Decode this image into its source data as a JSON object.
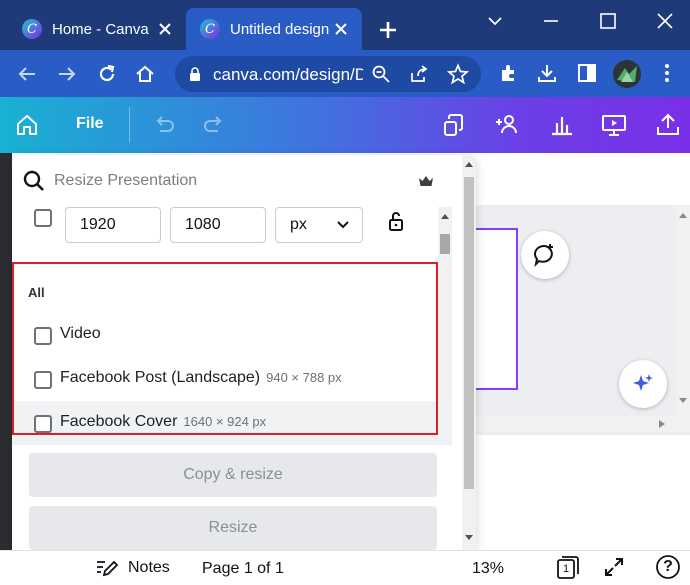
{
  "browser": {
    "tabs": [
      {
        "title": "Home - Canva",
        "active": false
      },
      {
        "title": "Untitled design",
        "active": true
      }
    ],
    "url": "canva.com/design/DAFh...",
    "accent": "#2a5cc6"
  },
  "canva_header": {
    "file_label": "File",
    "gradient_start": "#19b1d2",
    "gradient_end": "#7b2fe8"
  },
  "resize_panel": {
    "search_placeholder": "Resize Presentation",
    "width": "1920",
    "height": "1080",
    "unit": "px",
    "section_label": "All",
    "items": [
      {
        "label": "Video",
        "dimensions": ""
      },
      {
        "label": "Facebook Post (Landscape)",
        "dimensions": "940 × 788 px"
      },
      {
        "label": "Facebook Cover",
        "dimensions": "1640 × 924 px"
      }
    ],
    "copy_resize_label": "Copy & resize",
    "resize_label": "Resize",
    "highlight_color": "#e11d2a"
  },
  "bottom_bar": {
    "notes_label": "Notes",
    "page_info": "Page 1 of 1",
    "zoom": "13%",
    "page_count": "1",
    "help": "?"
  }
}
